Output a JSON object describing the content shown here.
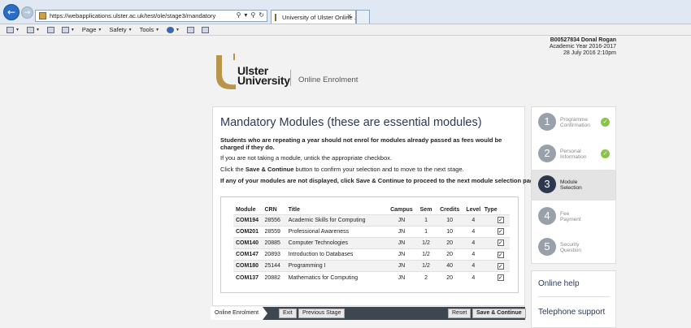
{
  "browser": {
    "url": "https://webapplications.ulster.ac.uk/test/ole/stage3/mandatory",
    "tab_title": "University of Ulster Online ...",
    "toolbar": {
      "page": "Page",
      "safety": "Safety",
      "tools": "Tools"
    }
  },
  "user": {
    "name": "B00527834 Donal Rogan",
    "academic_year": "Academic Year 2016-2017",
    "datetime": "28 July 2016 2:10pm"
  },
  "logo": {
    "line1": "Ulster",
    "line2": "University",
    "subtitle": "Online Enrolment"
  },
  "main": {
    "title": "Mandatory Modules (these are essential modules)",
    "warning": "Students who are repeating a year should not enrol for modules already passed as fees would be charged if they do.",
    "untick_note": "If you are not taking a module, untick the appropriate checkbox.",
    "click_prefix": "Click the ",
    "click_bold": "Save & Continue",
    "click_suffix": " button to confirm your selection and to move to the next stage.",
    "missing_note": "If any of your modules are not displayed, click Save & Continue to proceed to the next module selection page."
  },
  "table": {
    "headers": {
      "module": "Module",
      "crn": "CRN",
      "title": "Title",
      "campus": "Campus",
      "sem": "Sem",
      "credits": "Credits",
      "level": "Level",
      "type": "Type"
    },
    "rows": [
      {
        "module": "COM194",
        "crn": "28556",
        "title": "Academic Skills for Computing",
        "campus": "JN",
        "sem": "1",
        "credits": "10",
        "level": "4",
        "checked": true
      },
      {
        "module": "COM201",
        "crn": "28559",
        "title": "Professional Awareness",
        "campus": "JN",
        "sem": "1",
        "credits": "10",
        "level": "4",
        "checked": true
      },
      {
        "module": "COM140",
        "crn": "20885",
        "title": "Computer Technologies",
        "campus": "JN",
        "sem": "1/2",
        "credits": "20",
        "level": "4",
        "checked": true
      },
      {
        "module": "COM147",
        "crn": "20893",
        "title": "Introduction to Databases",
        "campus": "JN",
        "sem": "1/2",
        "credits": "20",
        "level": "4",
        "checked": true
      },
      {
        "module": "COM180",
        "crn": "25144",
        "title": "Programming I",
        "campus": "JN",
        "sem": "1/2",
        "credits": "40",
        "level": "4",
        "checked": true
      },
      {
        "module": "COM137",
        "crn": "20882",
        "title": "Mathematics for Computing",
        "campus": "JN",
        "sem": "2",
        "credits": "20",
        "level": "4",
        "checked": true
      }
    ]
  },
  "bottom": {
    "crumb": "Online Enrolment",
    "exit": "Exit",
    "previous": "Previous Stage",
    "reset": "Reset",
    "save": "Save & Continue"
  },
  "steps": [
    {
      "num": "1",
      "line1": "Programme",
      "line2": "Confirmation",
      "status": "complete"
    },
    {
      "num": "2",
      "line1": "Personal",
      "line2": "Information",
      "status": "complete"
    },
    {
      "num": "3",
      "line1": "Module",
      "line2": "Selection",
      "status": "active"
    },
    {
      "num": "4",
      "line1": "Fee",
      "line2": "Payment",
      "status": "pending"
    },
    {
      "num": "5",
      "line1": "Security",
      "line2": "Question",
      "status": "pending"
    }
  ],
  "help": {
    "online_help": "Online help",
    "telephone_support": "Telephone support"
  },
  "colors": {
    "accent_navy": "#2b3850",
    "check_green": "#8bc34a",
    "logo_gold": "#b8954a"
  }
}
